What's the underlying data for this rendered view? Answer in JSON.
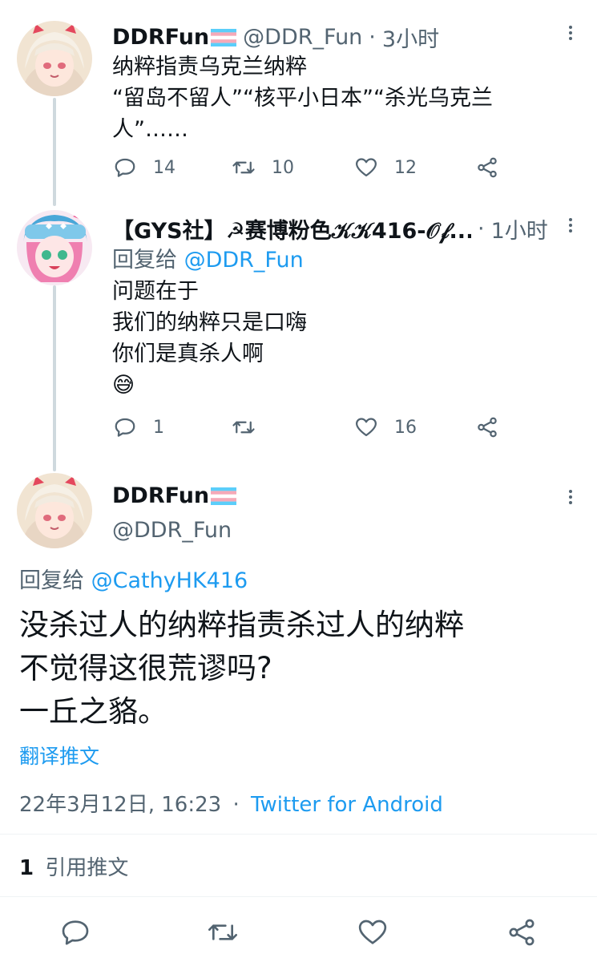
{
  "tweet1": {
    "name": "DDRFun",
    "handle": "@DDR_Fun",
    "sep": "·",
    "time": "3小时",
    "lines": [
      "纳粹指责乌克兰纳粹",
      "“留岛不留人”“核平小日本”“杀光乌克兰",
      "人”……"
    ],
    "reply_count": "14",
    "retweet_count": "10",
    "like_count": "12"
  },
  "tweet2": {
    "name": "【GYS社】☭赛博粉色𝒦𝒦416-𝒪𝒻...",
    "sep": "·",
    "time": "1小时",
    "reply_prefix": "回复给",
    "reply_to": "@DDR_Fun",
    "lines": [
      "问题在于",
      "我们的纳粹只是口嗨",
      "你们是真杀人啊"
    ],
    "emoji": "😅",
    "reply_count": "1",
    "retweet_count": "",
    "like_count": "16"
  },
  "main": {
    "name": "DDRFun",
    "handle": "@DDR_Fun",
    "reply_prefix": "回复给",
    "reply_to": "@CathyHK416",
    "lines": [
      "没杀过人的纳粹指责杀过人的纳粹",
      "不觉得这很荒谬吗?",
      "一丘之貉。"
    ],
    "translate": "翻译推文",
    "date": "22年3月12日, 16:23",
    "sep": "·",
    "source": "Twitter for Android",
    "quote_count": "1",
    "quote_label": "引用推文"
  },
  "colors": {
    "accent": "#1d9bf0",
    "text": "#0f1419",
    "muted": "#536471",
    "thread_line": "#cfd9de",
    "trans_blue": "#5bcefa",
    "trans_pink": "#f5a9b8"
  },
  "icons": [
    "more-icon",
    "reply-icon",
    "retweet-icon",
    "like-icon",
    "share-icon",
    "trans-flag"
  ]
}
